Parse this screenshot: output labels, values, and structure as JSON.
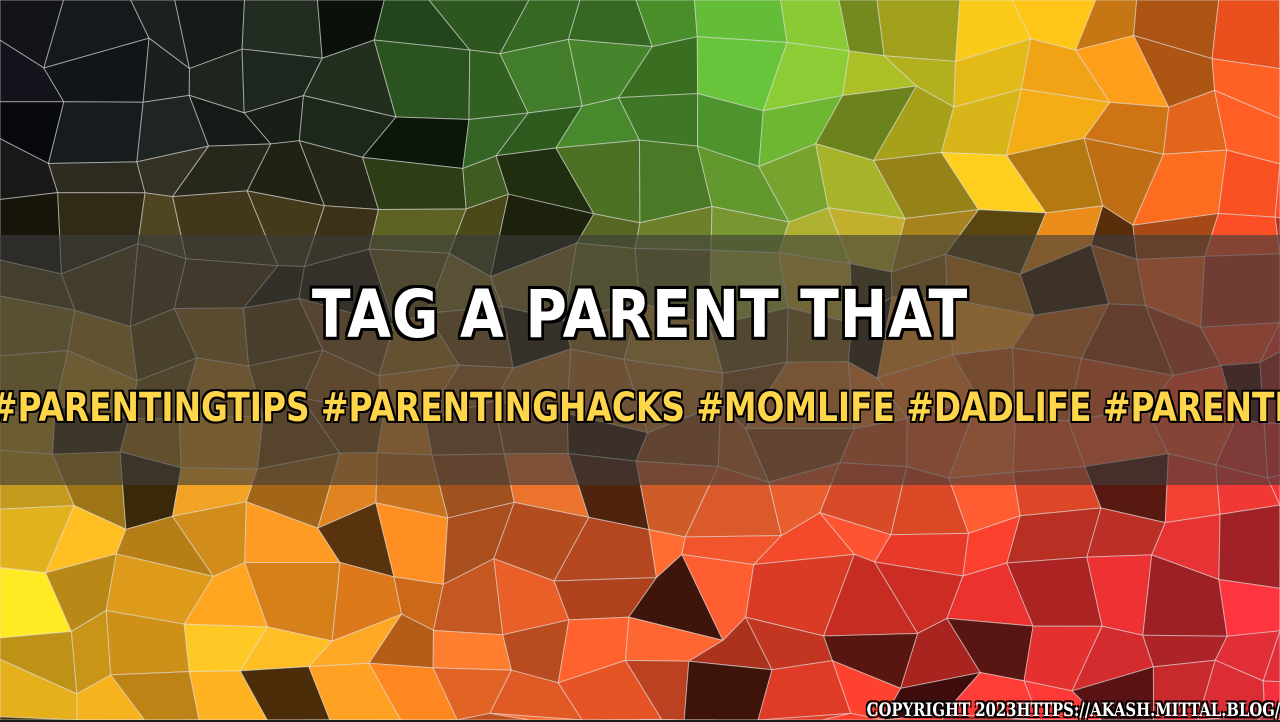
{
  "title": "TAG A PARENT THAT",
  "hashtags": "#PARENTINGTIPS #PARENTINGHACKS #MOMLIFE #DADLIFE #PARENTHOOD",
  "copyright": "COPYRIGHT 2023HTTPS://AKASH.MITTAL.BLOG/",
  "colors": {
    "overlay": "#3c3c3c",
    "title_text": "#ffffff",
    "hashtag_text": "#ffd54a",
    "outline": "#000000"
  }
}
